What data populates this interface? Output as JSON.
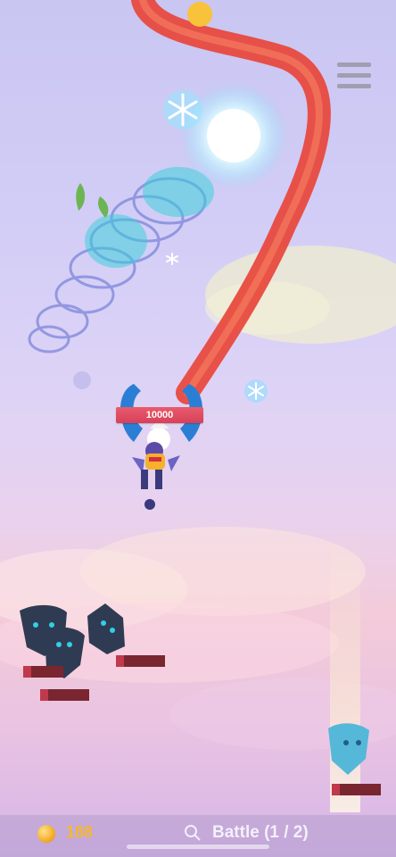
{
  "player": {
    "hp": "10000"
  },
  "hud": {
    "coins": "188",
    "battle_label": "Battle (1 / 2)"
  },
  "icons": {
    "menu": "hamburger-menu-icon",
    "coin": "coin-icon",
    "search": "search-icon",
    "snowflake": "snowflake-icon"
  },
  "colors": {
    "hp_bar": "#e04f63",
    "enemy_hp_bar": "#7a2631",
    "coin_text": "#f5b82e",
    "dragon": "#e8453a"
  }
}
